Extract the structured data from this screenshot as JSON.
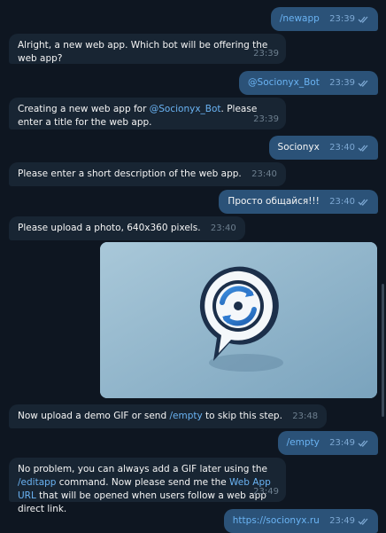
{
  "messages": [
    {
      "dir": "out",
      "text": "/newapp",
      "time": "23:39"
    },
    {
      "dir": "in",
      "text": "Alright, a new web app. Which bot will be offering the web app?",
      "time": "23:39"
    },
    {
      "dir": "out",
      "text": "@Socionyx_Bot",
      "time": "23:39"
    },
    {
      "dir": "in",
      "text_before": "Creating a new web app for ",
      "mention": "@Socionyx_Bot",
      "text_after": ". Please enter a title for the web app.",
      "time": "23:39"
    },
    {
      "dir": "out",
      "text": "Socionyx",
      "time": "23:40"
    },
    {
      "dir": "in",
      "text": "Please enter a short description of the web app.",
      "time": "23:40"
    },
    {
      "dir": "out",
      "text": "Просто общайся!!!",
      "time": "23:40"
    },
    {
      "dir": "in",
      "text": "Please upload a photo, 640x360 pixels.",
      "time": "23:40"
    },
    {
      "dir": "out",
      "type": "photo",
      "image_alt": "Chat bubble logo with circular arrows"
    },
    {
      "dir": "in",
      "text_before": "Now upload a demo GIF or send ",
      "command": "/empty",
      "text_after": " to skip this step.",
      "time": "23:48"
    },
    {
      "dir": "out",
      "text": "/empty",
      "time": "23:49"
    },
    {
      "dir": "in",
      "text_before": "No problem, you can always add a GIF later using the ",
      "command": "/editapp",
      "text_middle": " command. Now please send me the ",
      "link": "Web App URL",
      "text_after": " that will be opened when users follow a web app direct link.",
      "time": "23:49"
    },
    {
      "dir": "out",
      "text": "https://socionyx.ru",
      "time": "23:49"
    }
  ],
  "colors": {
    "background": "#0e1621",
    "incoming_bubble": "#182533",
    "outgoing_bubble": "#2b5278",
    "link": "#6ab3f3"
  }
}
